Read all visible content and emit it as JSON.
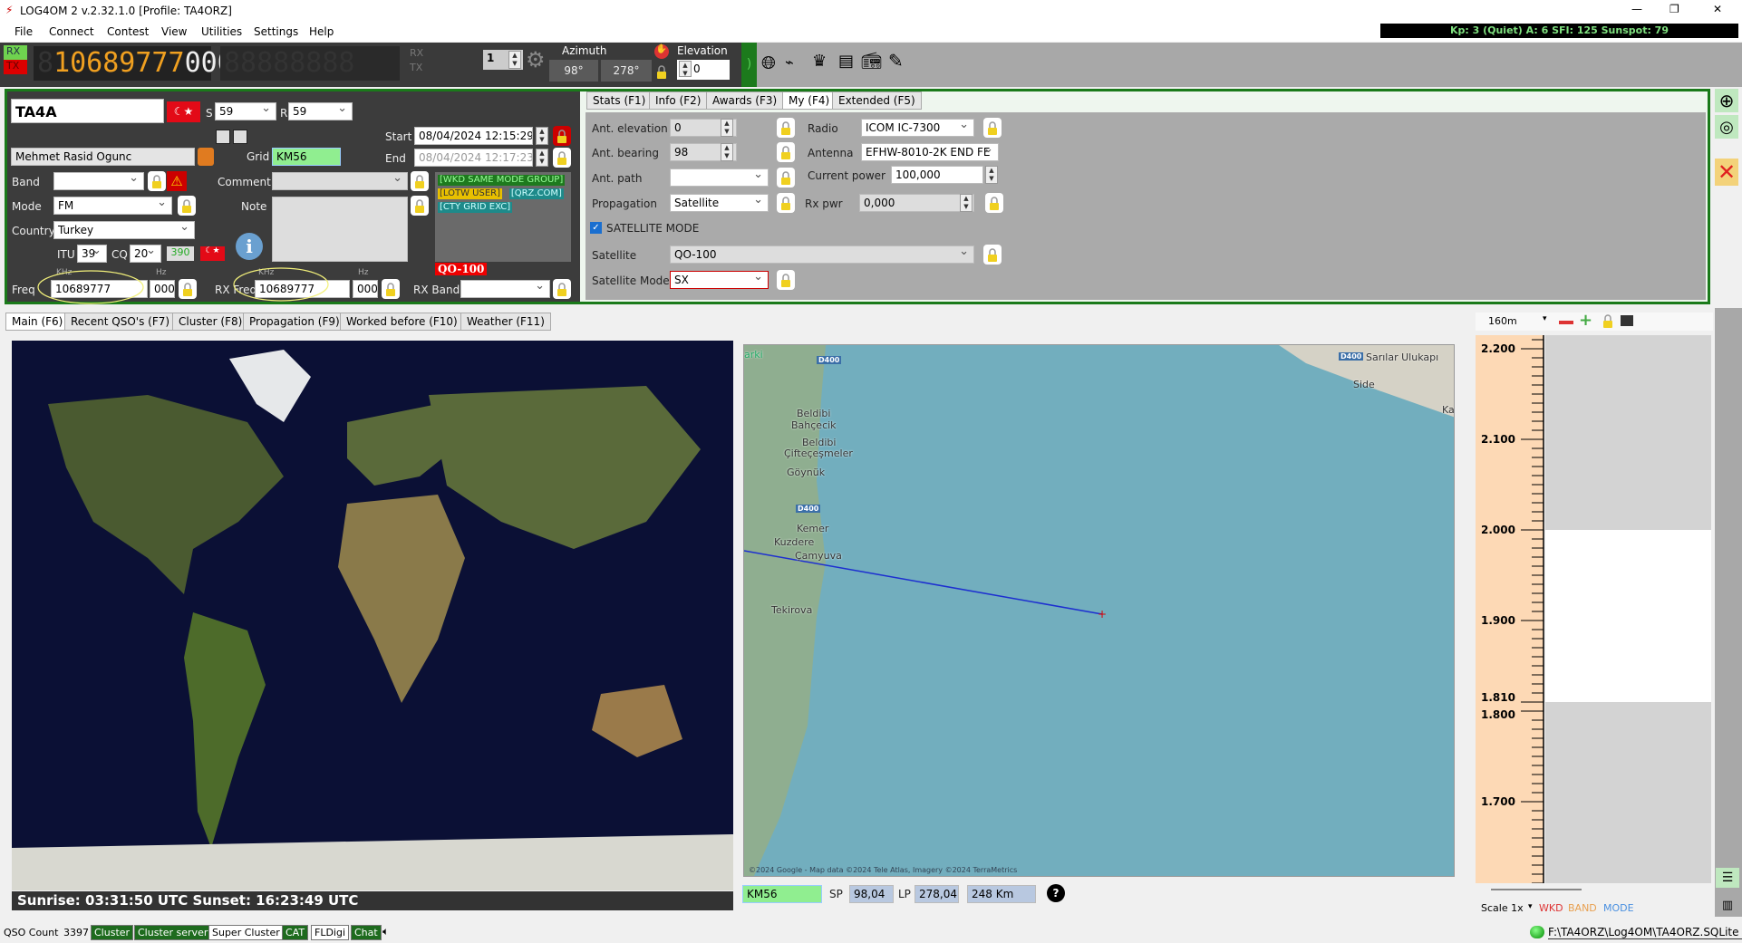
{
  "window": {
    "title": "LOG4OM 2 v.2.32.1.0 [Profile: TA4ORZ]",
    "minimize": "—",
    "maximize": "❐",
    "close": "✕"
  },
  "menu": [
    "File",
    "Connect",
    "Contest",
    "View",
    "Utilities",
    "Settings",
    "Help"
  ],
  "solar": "Kp: 3 (Quiet)  A: 6  SFI: 125 Sunspot: 79",
  "toolbar": {
    "rx": "RX",
    "tx": "TX",
    "freq_digits": "10689777",
    "freq_hz": "000",
    "rx_label": "RX",
    "tx_label": "TX",
    "vfo": "1",
    "azimuth_label": "Azimuth",
    "az_sp": "98°",
    "az_lp": "278°",
    "elevation_label": "Elevation",
    "elevation": "0",
    "icons": [
      "antenna-icon",
      "globe-icon",
      "satellite-dish-icon",
      "chess-king-icon",
      "server-icon",
      "radio-icon",
      "pen-icon"
    ]
  },
  "qso": {
    "callsign": "TA4A",
    "s_label": "S",
    "s_value": "59",
    "r_label": "R",
    "r_value": "59",
    "name": "Mehmet Rasid Ogunc",
    "grid_label": "Grid",
    "grid": "KM56",
    "start_label": "Start",
    "start": "08/04/2024 12:15:29",
    "end_label": "End",
    "end": "08/04/2024 12:17:23",
    "band_label": "Band",
    "band": "",
    "mode_label": "Mode",
    "mode": "FM",
    "country_label": "Country",
    "country": "Turkey",
    "itu_label": "ITU",
    "itu": "39",
    "cq_label": "CQ",
    "cq": "20",
    "dxcc": "390",
    "comment_label": "Comment",
    "comment": "",
    "note_label": "Note",
    "note": "",
    "tags": [
      {
        "text": "[WKD SAME MODE GROUP]",
        "color": "#1e7a1e"
      },
      {
        "text": "[LOTW USER]",
        "color": "#e8c000"
      },
      {
        "text": "[QRZ.COM]",
        "color": "#1e8a8a"
      },
      {
        "text": "[CTY GRID EXC]",
        "color": "#1e8a8a"
      }
    ],
    "sat_badge": "QO-100",
    "khz_label": "KHz",
    "hz_label": "Hz",
    "freq_label": "Freq",
    "freq_khz": "10689777",
    "freq_hz": "000",
    "rxfreq_label": "RX Freq",
    "rxfreq_khz": "10689777",
    "rxfreq_hz": "000",
    "rxband_label": "RX Band",
    "rxband": ""
  },
  "right_tabs": [
    "Stats (F1)",
    "Info (F2)",
    "Awards (F3)",
    "My (F4)",
    "Extended (F5)"
  ],
  "my": {
    "ant_elevation_label": "Ant. elevation",
    "ant_elevation": "0",
    "ant_bearing_label": "Ant. bearing",
    "ant_bearing": "98",
    "ant_path_label": "Ant. path",
    "ant_path": "",
    "propagation_label": "Propagation",
    "propagation": "Satellite",
    "sat_mode_check": "SATELLITE MODE",
    "sat_mode_checked": true,
    "satellite_label": "Satellite",
    "satellite": "QO-100",
    "satellite_mode_label": "Satellite Mode",
    "satellite_mode": "SX",
    "radio_label": "Radio",
    "radio": "ICOM IC-7300",
    "antenna_label": "Antenna",
    "antenna": "EFHW-8010-2K END FE",
    "power_label": "Current power",
    "power": "100,000",
    "rxpwr_label": "Rx pwr",
    "rxpwr": "0,000"
  },
  "bottom_tabs": [
    "Main (F6)",
    "Recent QSO's (F7)",
    "Cluster (F8)",
    "Propagation (F9)",
    "Worked before (F10)",
    "Weather (F11)"
  ],
  "sun": "Sunrise: 03:31:50 UTC  Sunset: 16:23:49 UTC",
  "map": {
    "labels": [
      "arki",
      "Beldibi",
      "Bahçecik",
      "Beldibi",
      "Çifteçeşmeler",
      "Göynük",
      "Kemer",
      "Kuzdere",
      "Çamyuva",
      "Tekirova",
      "Sarılar Ulukapı",
      "Side",
      "Ka"
    ],
    "roads": [
      "D400",
      "D400",
      "D400"
    ],
    "credit": "©2024 Google - Map data ©2024 Tele Atlas, Imagery ©2024 TerraMetrics",
    "grid": "KM56",
    "sp_label": "SP",
    "sp": "98,04",
    "lp_label": "LP",
    "lp": "278,04",
    "distance": "248 Km"
  },
  "bandmap": {
    "band": "160m",
    "ticks": [
      "2.200",
      "2.100",
      "2.000",
      "1.900",
      "1.810",
      "1.800",
      "1.700"
    ],
    "tick_values": [
      2.2,
      2.1,
      2.0,
      1.9,
      1.81,
      1.8,
      1.7
    ],
    "band_start": 1.81,
    "band_end": 2.0,
    "scale": "Scale 1x",
    "wkd": "WKD",
    "band_lbl": "BAND",
    "mode_lbl": "MODE"
  },
  "status": {
    "qso_count_label": "QSO Count",
    "qso_count": "3397",
    "items": [
      {
        "label": "Cluster",
        "on": true
      },
      {
        "label": "Cluster server",
        "on": true
      },
      {
        "label": "Super Cluster",
        "on": false
      },
      {
        "label": "CAT",
        "on": true
      },
      {
        "label": "FLDigi",
        "on": false
      },
      {
        "label": "Chat",
        "on": true
      }
    ],
    "db": "F:\\TA4ORZ\\Log4OM\\TA4ORZ.SQLite"
  }
}
